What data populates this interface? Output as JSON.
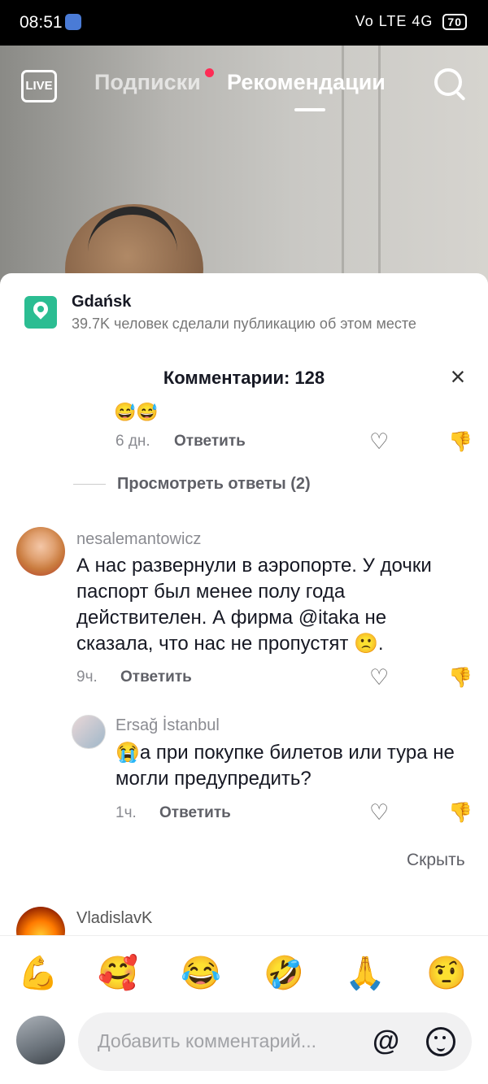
{
  "status": {
    "time": "08:51",
    "signal": "Vo LTE 4G",
    "battery": "70"
  },
  "nav": {
    "live": "LIVE",
    "tab_following": "Подписки",
    "tab_foryou": "Рекомендации"
  },
  "place": {
    "name": "Gdańsk",
    "subtitle": "39.7K человек сделали публикацию об этом месте"
  },
  "comments_title": "Комментарии: 128",
  "prev_comment": {
    "emoji": "😅😅",
    "time": "6 дн.",
    "reply": "Ответить",
    "view_replies": "Просмотреть ответы (2)"
  },
  "comment1": {
    "user": "nesalemantowicz",
    "lines": [
      "А нас развернули в аэропорте. У дочки",
      "паспорт был менее полу года",
      "действителен. А фирма @itaka не",
      "сказала, что нас не пропустят 🙁."
    ],
    "time": "9ч.",
    "reply": "Ответить"
  },
  "reply1": {
    "user": "Ersağ İstanbul",
    "lines": [
      "😭а при покупке билетов или тура не",
      "могли предупредить?"
    ],
    "time": "1ч.",
    "reply": "Ответить"
  },
  "hide": "Скрыть",
  "comment2": {
    "user": "VladislavK"
  },
  "emoji_bar": [
    "💪",
    "🥰",
    "😂",
    "🤣",
    "🙏",
    "🤨"
  ],
  "input": {
    "placeholder": "Добавить комментарий...",
    "at": "@"
  }
}
